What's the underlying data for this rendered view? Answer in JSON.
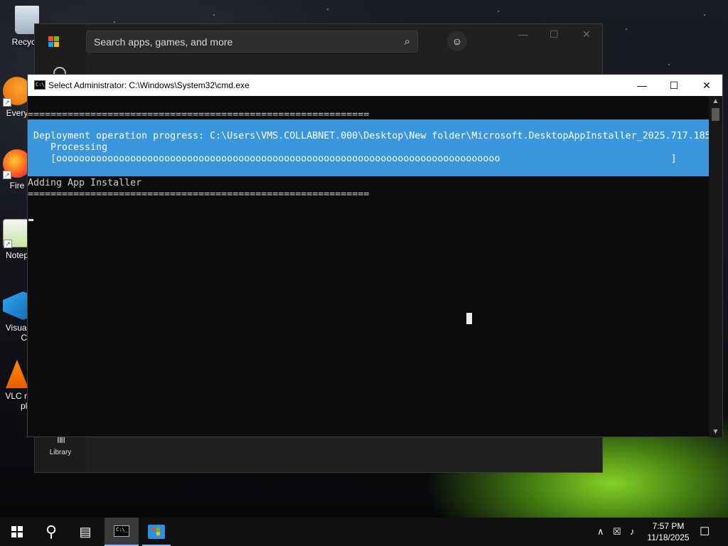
{
  "desktop": {
    "icons": [
      {
        "label": "Recycle",
        "icon": "recycle-bin-icon"
      },
      {
        "label": "Every",
        "icon": "everything-search-icon"
      },
      {
        "label": "Fire",
        "icon": "firefox-icon"
      },
      {
        "label": "Notep",
        "icon": "notepad-icon"
      },
      {
        "label": "Visual",
        "label2": "Co",
        "icon": "vscode-icon"
      },
      {
        "label": "VLC n",
        "label2": "pla",
        "icon": "vlc-icon"
      }
    ]
  },
  "store": {
    "search_placeholder": "Search apps, games, and more",
    "search_icon": "⌕",
    "user_icon": "☺",
    "minimize": "—",
    "maximize": "☐",
    "close": "✕",
    "library_label": "Library",
    "library_icon": "ⅡⅡ"
  },
  "cmd": {
    "title": "Select Administrator: C:\\Windows\\System32\\cmd.exe",
    "icon_text": "C:\\_",
    "minimize": "—",
    "maximize": "☐",
    "close": "✕",
    "separator_top": "============================================================",
    "progress_line1": "Deployment operation progress: C:\\Users\\VMS.COLLABNET.000\\Desktop\\New folder\\Microsoft.DesktopAppInstaller_2025.717.185",
    "progress_line2": "   Processing",
    "progress_line3": "   [oooooooooooooooooooooooooooooooooooooooooooooooooooooooooooooooooooooooooooooo                              ]",
    "progress_percent": 0.72,
    "adding_line": "Adding App Installer",
    "separator_bottom": "============================================================",
    "scroll_up": "▲",
    "scroll_down": "▼"
  },
  "taskbar": {
    "search_icon": "⚲",
    "task_view_icon": "▤",
    "tray_chevron": "∧",
    "network_icon": "☒",
    "volume_icon": "♪",
    "time": "7:57 PM",
    "date": "11/18/2025",
    "notification_icon": "☐"
  }
}
